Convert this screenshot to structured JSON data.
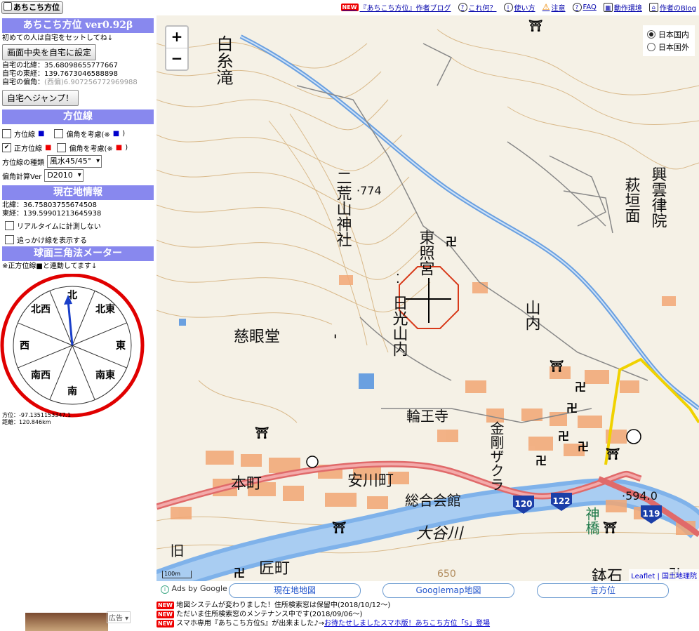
{
  "header": {
    "logo_text": "あちこち方位",
    "links": [
      {
        "new": "NEW",
        "label": "『あちこち方位』作者ブログ",
        "icon": ""
      },
      {
        "new": "",
        "label": "これ何？",
        "icon": "?"
      },
      {
        "new": "",
        "label": "使い方",
        "icon": "i"
      },
      {
        "new": "",
        "label": "注意",
        "icon": "!"
      },
      {
        "new": "",
        "label": "FAQ",
        "icon": "?"
      },
      {
        "new": "",
        "label": "動作環境",
        "icon": "▦"
      },
      {
        "new": "",
        "label": "作者のBlog",
        "icon": "⌂"
      }
    ]
  },
  "left": {
    "app_title": "あちこち方位 ver0.92β",
    "first_note": "初めての人は自宅をセットしてね↓",
    "set_home_button": "画面中央を自宅に設定",
    "home_lat": "自宅の北緯：35.68098655777667",
    "home_lng": "自宅の東経：139.7673046588898",
    "home_decl_label": "自宅の偏角：",
    "home_decl_value": "(西偏)6.907256772969988",
    "jump_home_button": "自宅へジャンプ！",
    "azimuth_header": "方位線",
    "azimuth_line": "方位線",
    "azimuth_decl": "偏角を考慮(※",
    "true_azimuth_line": "正方位線",
    "true_azimuth_decl": "偏角を考慮(※",
    "line_type_label": "方位線の種類",
    "line_type_value": "風水45/45°",
    "decl_ver_label": "偏角計算Ver",
    "decl_ver_value": "D2010",
    "current_header": "現在地情報",
    "cur_lat": "北緯：36.75803755674508",
    "cur_lng": "東経：139.59901213645938",
    "no_realtime": "リアルタイムに計測しない",
    "show_follow": "追っかけ線を表示する",
    "meter_header": "球面三角法メーター",
    "meter_note": "※正方位線■と連動してます↓",
    "directions": [
      "北",
      "北東",
      "東",
      "南東",
      "南",
      "南西",
      "西",
      "北西"
    ],
    "bearing": "方位：-97.1351153347.1",
    "distance": "距離：120.846km",
    "ad_label": "広告"
  },
  "map": {
    "zoom_in": "+",
    "zoom_out": "−",
    "region_options": [
      "日本国内",
      "日本国外"
    ],
    "attribution_leaflet": "Leaflet",
    "attribution_gsi": "国土地理院",
    "scale_label": "100m",
    "labels": [
      {
        "text": "白糸滝",
        "vertical": true
      },
      {
        "text": "二荒山神社",
        "vertical": true
      },
      {
        "text": "·774",
        "vertical": false
      },
      {
        "text": "東照宮",
        "vertical": true
      },
      {
        "text": "日光山内",
        "vertical": true
      },
      {
        "text": "慈眼堂",
        "vertical": false
      },
      {
        "text": "山内",
        "vertical": true
      },
      {
        "text": "萩垣面",
        "vertical": true
      },
      {
        "text": "興雲律院",
        "vertical": true
      },
      {
        "text": "輪王寺",
        "vertical": false
      },
      {
        "text": "金剛ザクラ",
        "vertical": true
      },
      {
        "text": "本町",
        "vertical": false
      },
      {
        "text": "安川町",
        "vertical": false
      },
      {
        "text": "総合会館",
        "vertical": false
      },
      {
        "text": "大谷川",
        "vertical": false
      },
      {
        "text": "神橋",
        "vertical": true
      },
      {
        "text": "·594.0",
        "vertical": false
      },
      {
        "text": "旧",
        "vertical": true
      },
      {
        "text": "匠町",
        "vertical": false
      },
      {
        "text": "鉢石",
        "vertical": false
      },
      {
        "text": "650",
        "vertical": false
      }
    ],
    "route_shields": [
      "120",
      "122",
      "119"
    ]
  },
  "bottom": {
    "ads_by": "Ads by Google",
    "buttons": [
      "現在地地図",
      "Googlemap地図",
      "吉方位"
    ],
    "news": [
      {
        "badge": "NEW",
        "text": "地図システムが変わりました！住所検索窓は保留中(2018/10/12〜)",
        "link": ""
      },
      {
        "badge": "NEW",
        "text": "ただいま住所検索窓のメンテナンス中です(2018/09/06〜)",
        "link": ""
      },
      {
        "badge": "NEW",
        "text": "スマホ専用『あちこち方位S』が出来ました♪→",
        "link": "お待たせしましたスマホ版！あちこち方位「S」登場"
      }
    ]
  },
  "colors": {
    "header_bg": "#8888ee",
    "meter_circle": "#e00000",
    "needle": "#1a3fc9",
    "road": "#e06a6a",
    "river": "#6aa0e0"
  }
}
